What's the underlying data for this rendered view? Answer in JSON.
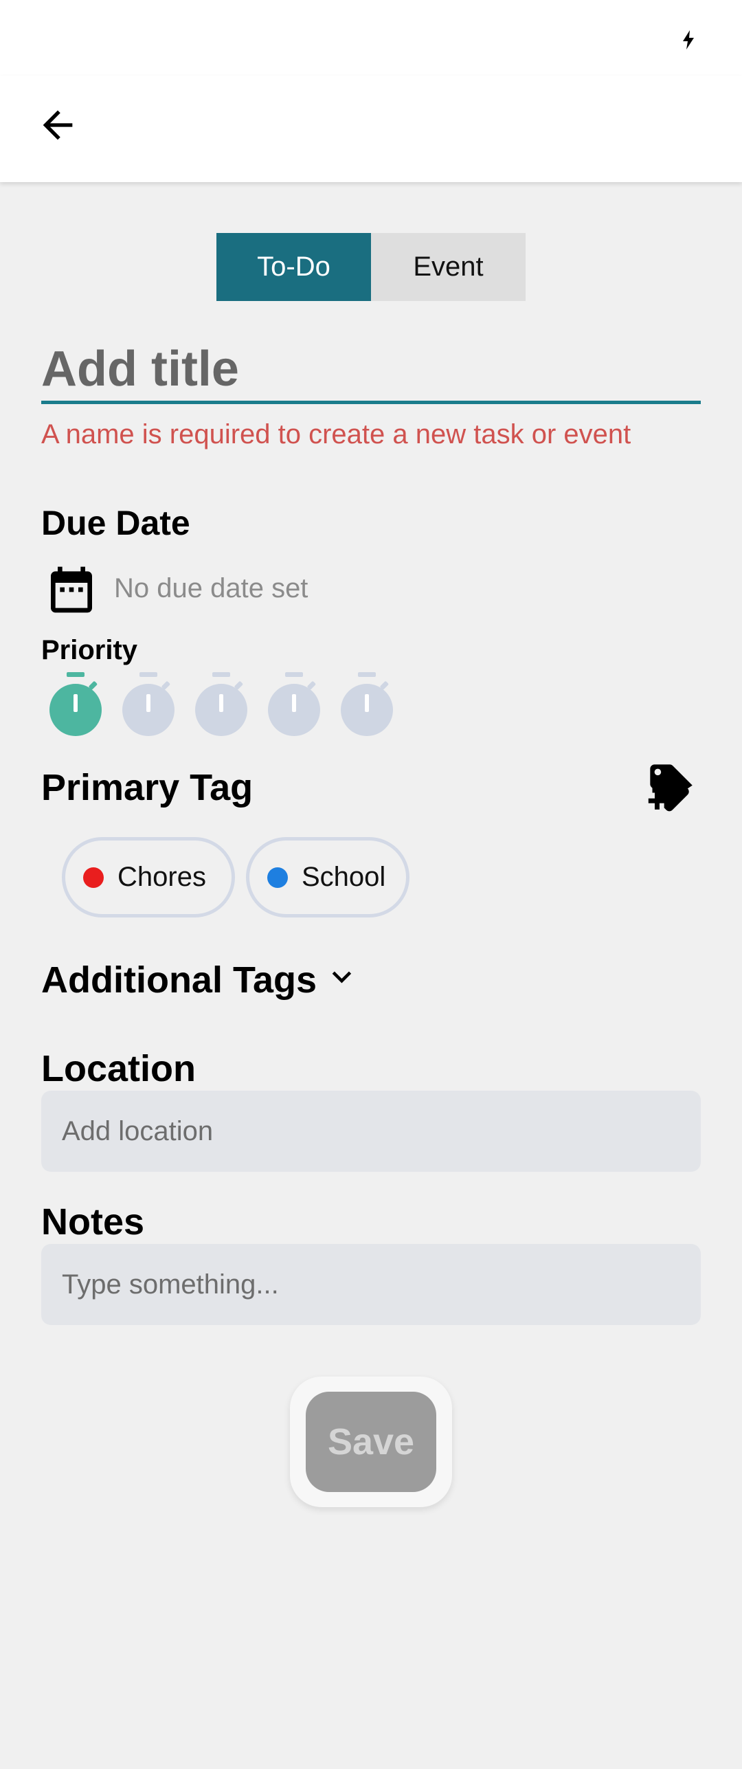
{
  "type_toggle": {
    "todo_label": "To-Do",
    "event_label": "Event",
    "selected": "To-Do"
  },
  "title_field": {
    "placeholder": "Add title",
    "value": ""
  },
  "title_error": "A name is required to create a new task or event",
  "due_date": {
    "label": "Due Date",
    "value": "No due date set",
    "icon": "calendar-icon"
  },
  "priority": {
    "label": "Priority",
    "level": 1,
    "max": 5,
    "active_color": "#4db6a0",
    "inactive_color": "#cfd6e3"
  },
  "primary_tag": {
    "label": "Primary Tag",
    "add_icon": "add-tag-icon",
    "tags": [
      {
        "label": "Chores",
        "color": "#e91e1e"
      },
      {
        "label": "School",
        "color": "#1e7fe0"
      }
    ]
  },
  "additional_tags": {
    "label": "Additional Tags",
    "icon": "chevron-down-icon"
  },
  "location": {
    "label": "Location",
    "placeholder": "Add location",
    "value": ""
  },
  "notes": {
    "label": "Notes",
    "placeholder": "Type something...",
    "value": ""
  },
  "save": {
    "label": "Save",
    "enabled": false
  },
  "colors": {
    "accent": "#1a6e80",
    "error": "#d0524f"
  }
}
